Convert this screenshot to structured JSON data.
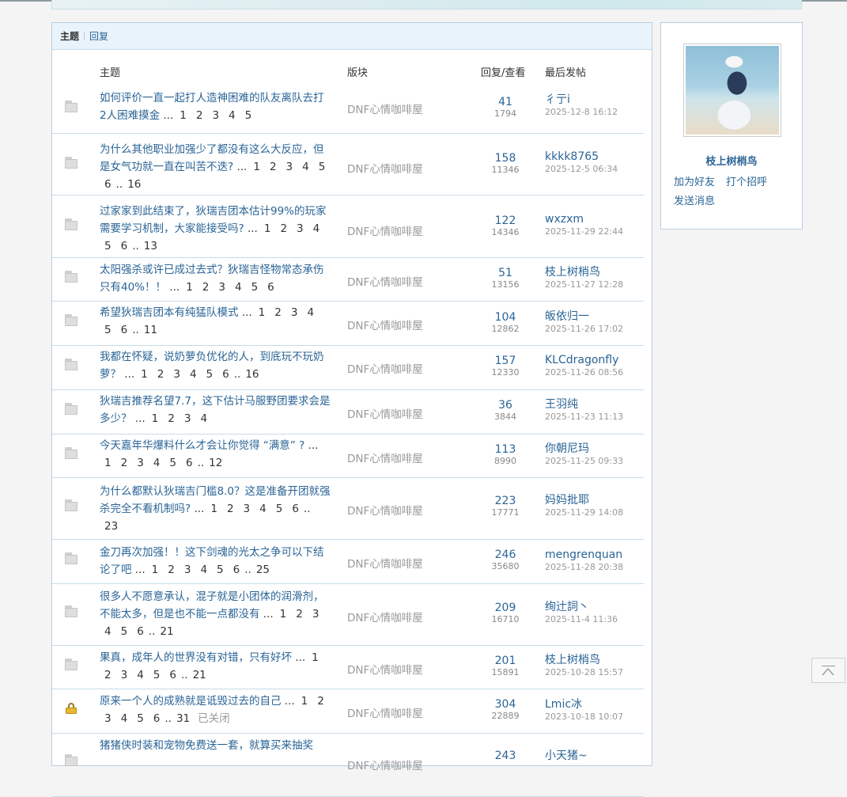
{
  "tabs": [
    {
      "label": "主题"
    },
    {
      "label": "回复"
    }
  ],
  "list_header": {
    "topic": "主题",
    "forum": "版块",
    "stats": "回复/查看",
    "last": "最后发帖"
  },
  "threads": [
    {
      "title": "如何评价一直一起打人造神困难的队友离队去打2人困难摸金",
      "pages": [
        "1",
        "2",
        "3",
        "4",
        "5"
      ],
      "forum": "DNF心情咖啡屋",
      "replies": "41",
      "views": "1794",
      "last_user": "彳亍i",
      "last_time": "2025-12-8 16:12"
    },
    {
      "title": "为什么其他职业加强少了都没有这么大反应，但是女气功就一直在叫苦不迭?",
      "pages": [
        "1",
        "2",
        "3",
        "4",
        "5",
        "6",
        "16"
      ],
      "forum": "DNF心情咖啡屋",
      "replies": "158",
      "views": "11346",
      "last_user": "kkkk8765",
      "last_time": "2025-12-5 06:34"
    },
    {
      "title": "过家家到此结束了，狄瑞吉团本估计99%的玩家需要学习机制，大家能接受吗?",
      "pages": [
        "1",
        "2",
        "3",
        "4",
        "5",
        "6",
        "13"
      ],
      "forum": "DNF心情咖啡屋",
      "replies": "122",
      "views": "14346",
      "last_user": "wxzxm",
      "last_time": "2025-11-29 22:44"
    },
    {
      "title": "太阳强杀或许已成过去式？狄瑞吉怪物常态承伤只有40%！！",
      "pages": [
        "1",
        "2",
        "3",
        "4",
        "5",
        "6"
      ],
      "forum": "DNF心情咖啡屋",
      "replies": "51",
      "views": "13156",
      "last_user": "枝上树梢鸟",
      "last_time": "2025-11-27 12:28"
    },
    {
      "title": "希望狄瑞吉团本有纯猛队模式",
      "pages": [
        "1",
        "2",
        "3",
        "4",
        "5",
        "6",
        "11"
      ],
      "forum": "DNF心情咖啡屋",
      "replies": "104",
      "views": "12862",
      "last_user": "皈依归一",
      "last_time": "2025-11-26 17:02"
    },
    {
      "title": "我都在怀疑，说奶萝负优化的人，到底玩不玩奶萝？",
      "pages": [
        "1",
        "2",
        "3",
        "4",
        "5",
        "6",
        "16"
      ],
      "forum": "DNF心情咖啡屋",
      "replies": "157",
      "views": "12330",
      "last_user": "KLCdragonfly",
      "last_time": "2025-11-26 08:56"
    },
    {
      "title": "狄瑞吉推荐名望7.7，这下估计马服野团要求会是多少？",
      "pages": [
        "1",
        "2",
        "3",
        "4"
      ],
      "forum": "DNF心情咖啡屋",
      "replies": "36",
      "views": "3844",
      "last_user": "王羽纯",
      "last_time": "2025-11-23 11:13"
    },
    {
      "title": "今天嘉年华爆料什么才会让你觉得 “满意” ?",
      "pages": [
        "1",
        "2",
        "3",
        "4",
        "5",
        "6",
        "12"
      ],
      "forum": "DNF心情咖啡屋",
      "replies": "113",
      "views": "8990",
      "last_user": "你朝尼玛",
      "last_time": "2025-11-25 09:33"
    },
    {
      "title": "为什么都默认狄瑞吉门槛8.0？这是准备开团就强杀完全不看机制吗?",
      "pages": [
        "1",
        "2",
        "3",
        "4",
        "5",
        "6",
        "23"
      ],
      "forum": "DNF心情咖啡屋",
      "replies": "223",
      "views": "17771",
      "last_user": "妈妈批耶",
      "last_time": "2025-11-29 14:08"
    },
    {
      "title": "金刀再次加强！！这下剑魂的光太之争可以下结论了吧",
      "pages": [
        "1",
        "2",
        "3",
        "4",
        "5",
        "6",
        "25"
      ],
      "forum": "DNF心情咖啡屋",
      "replies": "246",
      "views": "35680",
      "last_user": "mengrenquan",
      "last_time": "2025-11-28 20:38"
    },
    {
      "title": "很多人不愿意承认，混子就是小团体的润滑剂，不能太多，但是也不能一点都没有",
      "pages": [
        "1",
        "2",
        "3",
        "4",
        "5",
        "6",
        "21"
      ],
      "forum": "DNF心情咖啡屋",
      "replies": "209",
      "views": "16710",
      "last_user": "绚辻詞丶",
      "last_time": "2025-11-4 11:36"
    },
    {
      "title": "果真，成年人的世界没有对错，只有好坏",
      "pages": [
        "1",
        "2",
        "3",
        "4",
        "5",
        "6",
        "21"
      ],
      "forum": "DNF心情咖啡屋",
      "replies": "201",
      "views": "15891",
      "last_user": "枝上树梢鸟",
      "last_time": "2025-10-28 15:57"
    },
    {
      "title": "原来一个人的成熟就是诋毁过去的自己",
      "pages": [
        "1",
        "2",
        "3",
        "4",
        "5",
        "6",
        "31"
      ],
      "closed": "已关闭",
      "forum": "DNF心情咖啡屋",
      "replies": "304",
      "views": "22889",
      "last_user": "Lmic冰",
      "last_time": "2023-10-18 10:07"
    },
    {
      "title": "猪猪侠时装和宠物免费送一套，就算买来抽奖",
      "pages": [],
      "forum": "DNF心情咖啡屋",
      "replies": "243",
      "views": "",
      "last_user": "小天猪~",
      "last_time": ""
    }
  ],
  "profile": {
    "name": "枝上树梢鸟",
    "add_friend": "加为好友",
    "greet": "打个招呼",
    "send_message": "发送消息"
  },
  "ellipsis": "...",
  "gap": ".."
}
